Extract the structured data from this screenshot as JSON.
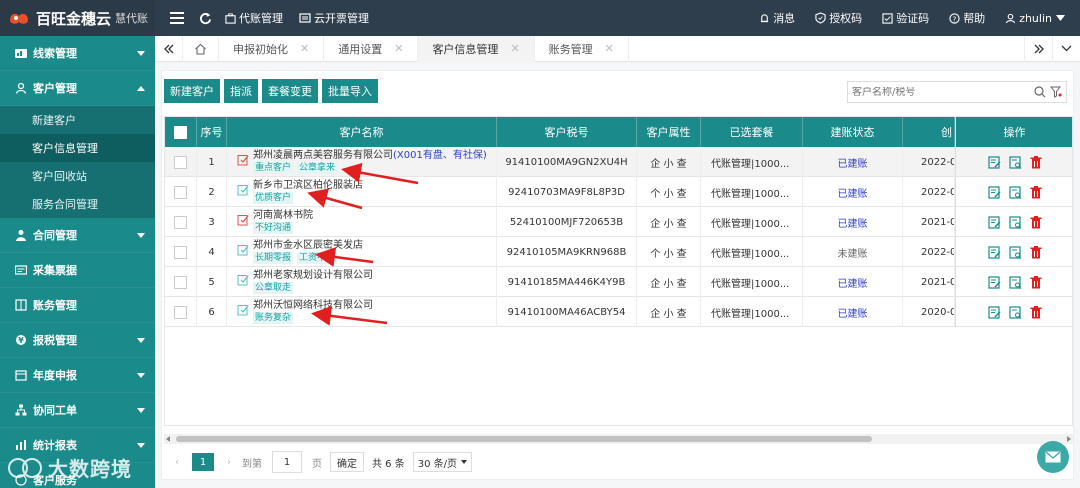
{
  "brand": {
    "name": "百旺金穗云",
    "sub": "慧代账"
  },
  "topnav": {
    "left": [
      "代账管理",
      "云开票管理"
    ],
    "right": [
      "消息",
      "授权码",
      "验证码",
      "帮助",
      "zhulin"
    ]
  },
  "sidebar": {
    "groups": [
      {
        "label": "线索管理",
        "icon": "chart-icon"
      },
      {
        "label": "客户管理",
        "icon": "user-icon",
        "expanded": true,
        "items": [
          "新建客户",
          "客户信息管理",
          "客户回收站",
          "服务合同管理"
        ]
      },
      {
        "label": "合同管理",
        "icon": "person-icon"
      },
      {
        "label": "采集票据",
        "icon": "card-icon"
      },
      {
        "label": "账务管理",
        "icon": "book-icon"
      },
      {
        "label": "报税管理",
        "icon": "money-icon"
      },
      {
        "label": "年度申报",
        "icon": "calendar-icon"
      },
      {
        "label": "协同工单",
        "icon": "flow-icon"
      },
      {
        "label": "统计报表",
        "icon": "bar-icon"
      },
      {
        "label": "客户服务",
        "icon": "service-icon"
      }
    ]
  },
  "tabs": [
    {
      "label": "申报初始化"
    },
    {
      "label": "通用设置"
    },
    {
      "label": "客户信息管理",
      "active": true
    },
    {
      "label": "账务管理"
    }
  ],
  "toolbar": {
    "buttons": [
      "新建客户",
      "指派",
      "套餐变更",
      "批量导入"
    ]
  },
  "search": {
    "placeholder": "客户名称/税号"
  },
  "table": {
    "headers": [
      "序号",
      "客户名称",
      "客户税号",
      "客户属性",
      "已选套餐",
      "建账状态",
      "创",
      "操作"
    ],
    "rows": [
      {
        "no": "1",
        "name": "郑州凌晨两点美容服务有限公司",
        "extra": "(X001有盘、有社保)",
        "tags": [
          "重点客户",
          "公章拿来"
        ],
        "tax": "91410100MA9GN2XU4H",
        "attr": "企 小 查",
        "pkg": "代账管理|1000...",
        "status": "已建账",
        "date": "2022-0"
      },
      {
        "no": "2",
        "name": "新乡市卫滨区柏伦服装店",
        "extra": "",
        "tags": [
          "优质客户"
        ],
        "tax": "92410703MA9F8L8P3D",
        "attr": "个 小 查",
        "pkg": "代账管理|1000...",
        "status": "已建账",
        "date": "2022-0"
      },
      {
        "no": "3",
        "name": "河南嵩林书院",
        "extra": "",
        "tags": [
          "不好沟通"
        ],
        "tax": "52410100MJF720653B",
        "attr": "企 小 查",
        "pkg": "代账管理|1000...",
        "status": "已建账",
        "date": "2021-0"
      },
      {
        "no": "4",
        "name": "郑州市金水区辰密美发店",
        "extra": "",
        "tags": [
          "长期零报",
          "工资不变"
        ],
        "tax": "92410105MA9KRN968B",
        "attr": "个 小 查",
        "pkg": "代账管理|1000...",
        "status": "未建账",
        "date": "2022-0"
      },
      {
        "no": "5",
        "name": "郑州老家规划设计有限公司",
        "extra": "",
        "tags": [
          "公章取走"
        ],
        "tax": "91410185MA446K4Y9B",
        "attr": "企 小 查",
        "pkg": "代账管理|1000...",
        "status": "已建账",
        "date": "2021-0"
      },
      {
        "no": "6",
        "name": "郑州沃恒网络科技有限公司",
        "extra": "",
        "tags": [
          "账务复杂"
        ],
        "tax": "91410100MA46ACBY54",
        "attr": "企 小 查",
        "pkg": "代账管理|1000...",
        "status": "已建账",
        "date": "2020-0"
      }
    ]
  },
  "pager": {
    "current": "1",
    "goto_label": "到第",
    "goto_value": "1",
    "page_label": "页",
    "ok": "确定",
    "total": "共 6 条",
    "size": "30 条/页"
  },
  "watermark": "大数跨境",
  "colors": {
    "primary": "#1b8a8a",
    "topbar": "#2f3e4c",
    "link": "#2d3ec7",
    "arrow": "#e02020"
  }
}
